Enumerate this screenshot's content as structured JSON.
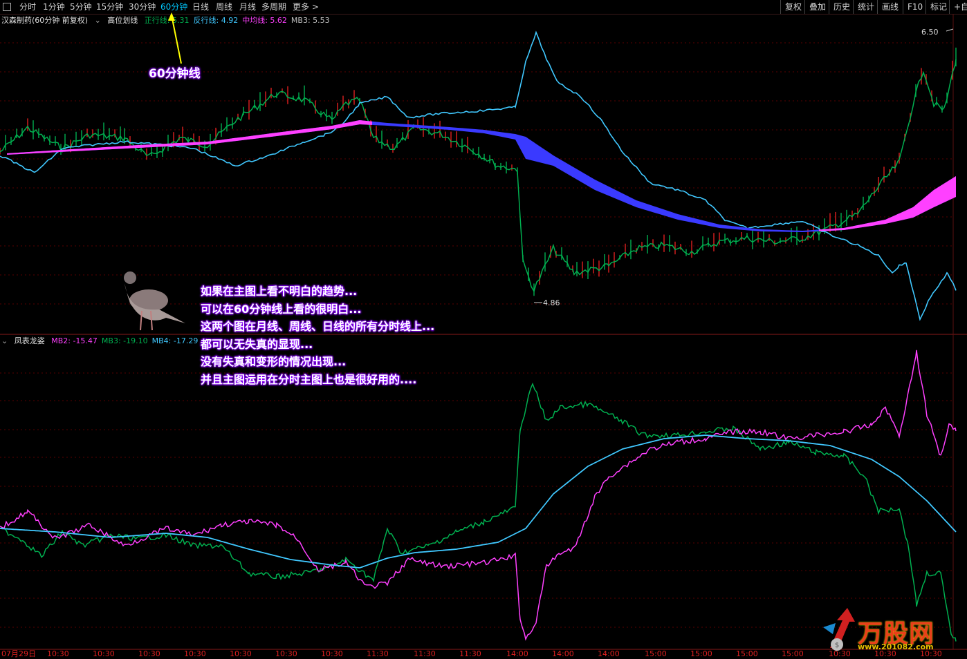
{
  "toolbar": {
    "periods": [
      {
        "label": "分时",
        "active": false
      },
      {
        "label": "1分钟",
        "active": false
      },
      {
        "label": "5分钟",
        "active": false
      },
      {
        "label": "15分钟",
        "active": false
      },
      {
        "label": "30分钟",
        "active": false
      },
      {
        "label": "60分钟",
        "active": true
      },
      {
        "label": "日线",
        "active": false
      },
      {
        "label": "周线",
        "active": false
      },
      {
        "label": "月线",
        "active": false
      },
      {
        "label": "多周期",
        "active": false
      },
      {
        "label": "更多 >",
        "active": false
      }
    ],
    "right_buttons": [
      "复权",
      "叠加",
      "历史",
      "统计",
      "画线",
      "F10",
      "标记",
      "+自选"
    ]
  },
  "main_chart": {
    "stock_title": "汉森制药(60分钟 前复权)",
    "indicator_name": "高位划线",
    "legend": [
      {
        "label": "正行线: 5.31",
        "color": "#00b050"
      },
      {
        "label": "反行线: 4.92",
        "color": "#40c8ff"
      },
      {
        "label": "中均线: 5.62",
        "color": "#ff40ff"
      },
      {
        "label": "MB3: 5.53",
        "color": "#c0c0c0"
      }
    ],
    "high_label": "6.50",
    "low_label": "4.86",
    "callout": "60分钟线"
  },
  "sub_chart": {
    "indicator_name": "凤表龙姿",
    "legend": [
      {
        "label": "MB2: -15.47",
        "color": "#ff40ff"
      },
      {
        "label": "MB3: -19.10",
        "color": "#00b050"
      },
      {
        "label": "MB4: -17.29",
        "color": "#40c8ff"
      }
    ]
  },
  "annotation": [
    "如果在主图上看不明白的趋势...",
    "可以在60分钟线上看的很明白...",
    "这两个图在月线、周线、日线的所有分时线上...",
    "都可以无失真的显现...",
    "没有失真和变形的情况出现...",
    "并且主图运用在分时主图上也是很好用的...."
  ],
  "x_axis": [
    "07月29日",
    "10:30",
    "10:30",
    "10:30",
    "10:30",
    "10:30",
    "10:30",
    "10:30",
    "11:30",
    "11:30",
    "11:30",
    "14:00",
    "14:00",
    "14:00",
    "15:00",
    "15:00",
    "15:00",
    "15:00",
    "10:30",
    "10:30",
    "10:30"
  ],
  "watermark": {
    "brand": "万股网",
    "url": "www.201082.com"
  },
  "colors": {
    "background": "#000000",
    "grid": "#5a0000",
    "green": "#00b050",
    "cyan": "#40c8ff",
    "magenta": "#ff40ff",
    "blue_band": "#3a3aff",
    "up": "#e02020"
  }
}
